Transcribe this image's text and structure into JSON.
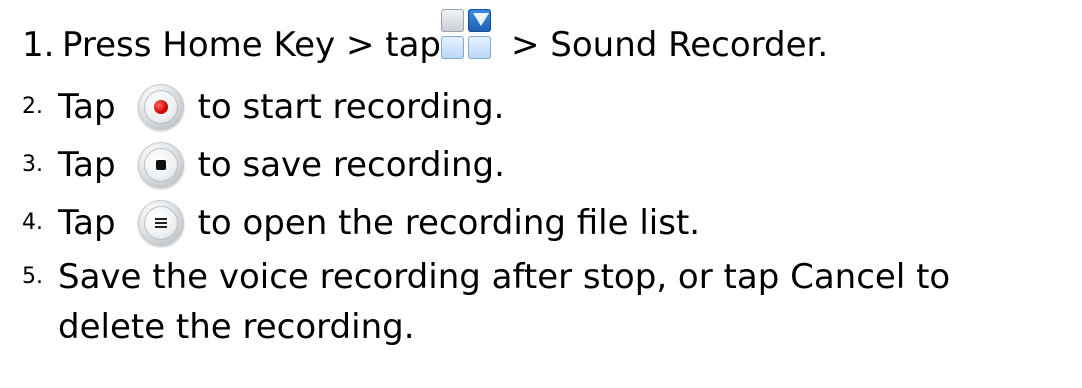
{
  "steps": [
    {
      "number": "1.",
      "parts": [
        "Press Home Key > tap",
        "> Sound Recorder."
      ],
      "icon": "apps-grid-icon"
    },
    {
      "number": "2.",
      "prefix": "Tap",
      "suffix": "to start recording.",
      "icon": "record-button-icon"
    },
    {
      "number": "3.",
      "prefix": "Tap",
      "suffix": "to save recording.",
      "icon": "stop-button-icon"
    },
    {
      "number": "4.",
      "prefix": "Tap",
      "suffix": "to open the recording file list.",
      "icon": "list-button-icon"
    },
    {
      "number": "5.",
      "line1": "Save the voice recording after stop, or tap Cancel to",
      "line2": "delete the recording."
    }
  ],
  "colors": {
    "text": "#000000",
    "record_red": "#d90000",
    "apps_blue": "#1c5fb3"
  }
}
